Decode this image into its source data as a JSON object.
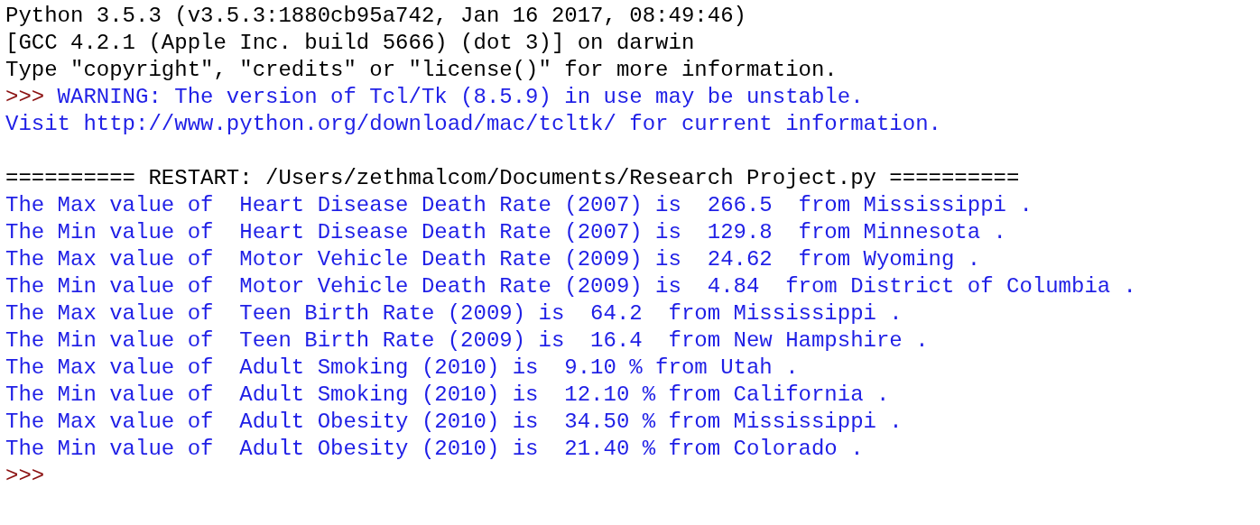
{
  "shell": {
    "lines": [
      {
        "kind": "header",
        "text": "Python 3.5.3 (v3.5.3:1880cb95a742, Jan 16 2017, 08:49:46)"
      },
      {
        "kind": "header",
        "text": "[GCC 4.2.1 (Apple Inc. build 5666) (dot 3)] on darwin"
      },
      {
        "kind": "header",
        "text": "Type \"copyright\", \"credits\" or \"license()\" for more information."
      },
      {
        "kind": "stdout",
        "prompt": ">>>",
        "text": "WARNING: The version of Tcl/Tk (8.5.9) in use may be unstable."
      },
      {
        "kind": "stdout",
        "text": "Visit http://www.python.org/download/mac/tcltk/ for current information."
      },
      {
        "kind": "blank"
      },
      {
        "kind": "header",
        "text": "========== RESTART: /Users/zethmalcom/Documents/Research Project.py =========="
      },
      {
        "kind": "stdout",
        "text": "The Max value of  Heart Disease Death Rate (2007) is  266.5  from Mississippi ."
      },
      {
        "kind": "stdout",
        "text": "The Min value of  Heart Disease Death Rate (2007) is  129.8  from Minnesota ."
      },
      {
        "kind": "stdout",
        "text": "The Max value of  Motor Vehicle Death Rate (2009) is  24.62  from Wyoming ."
      },
      {
        "kind": "stdout",
        "text": "The Min value of  Motor Vehicle Death Rate (2009) is  4.84  from District of Columbia ."
      },
      {
        "kind": "stdout",
        "text": "The Max value of  Teen Birth Rate (2009) is  64.2  from Mississippi ."
      },
      {
        "kind": "stdout",
        "text": "The Min value of  Teen Birth Rate (2009) is  16.4  from New Hampshire ."
      },
      {
        "kind": "stdout",
        "text": "The Max value of  Adult Smoking (2010) is  9.10 % from Utah ."
      },
      {
        "kind": "stdout",
        "text": "The Min value of  Adult Smoking (2010) is  12.10 % from California ."
      },
      {
        "kind": "stdout",
        "text": "The Max value of  Adult Obesity (2010) is  34.50 % from Mississippi ."
      },
      {
        "kind": "stdout",
        "text": "The Min value of  Adult Obesity (2010) is  21.40 % from Colorado ."
      },
      {
        "kind": "prompt",
        "prompt": ">>>"
      }
    ]
  }
}
